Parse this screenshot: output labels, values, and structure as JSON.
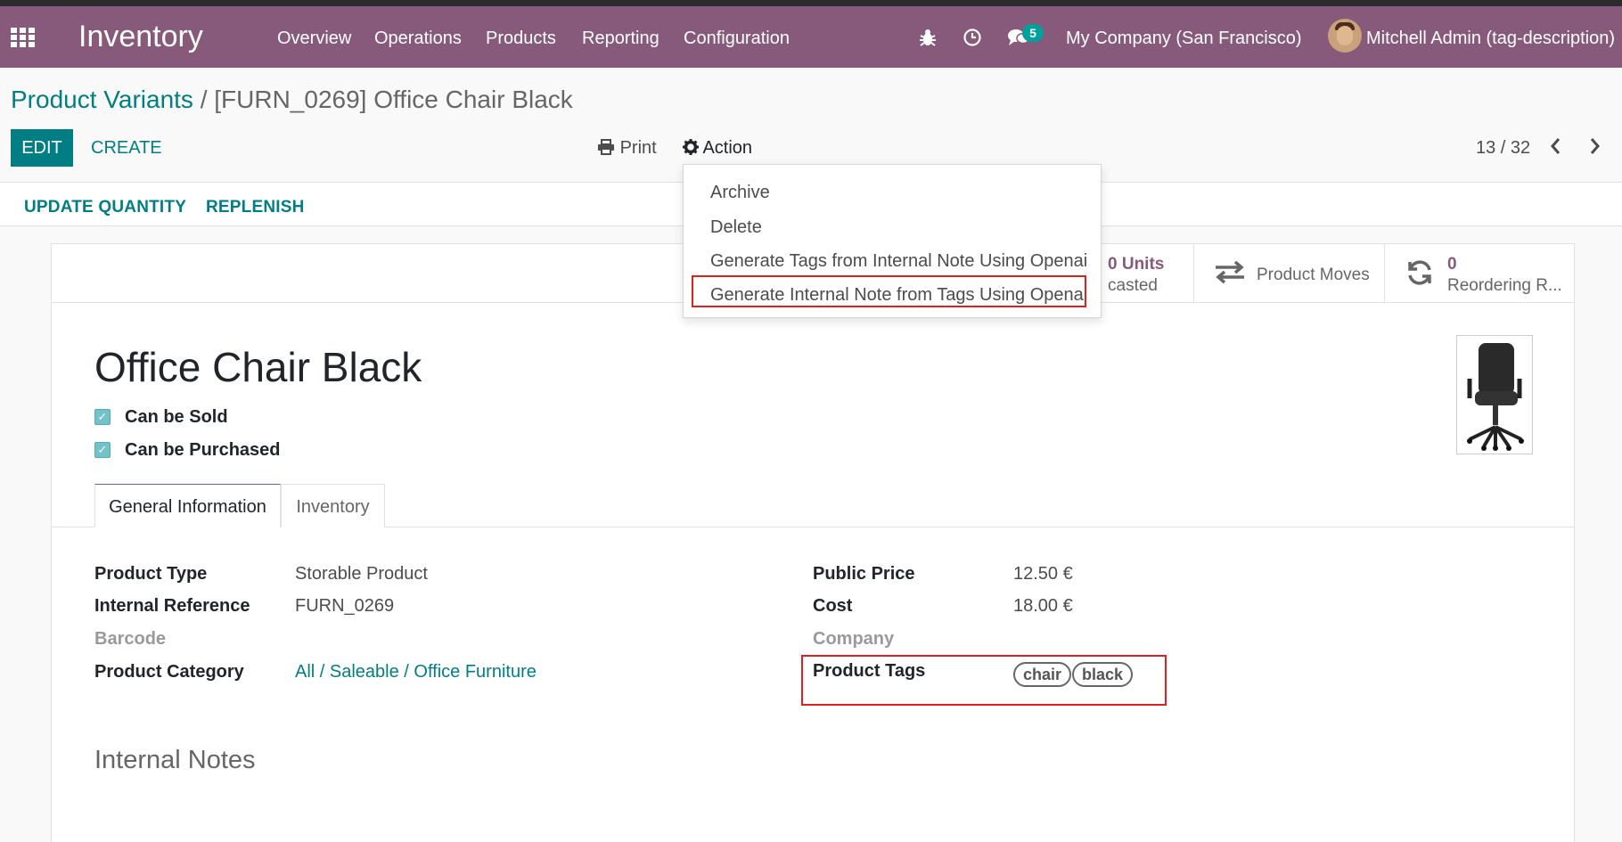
{
  "navbar": {
    "app_name": "Inventory",
    "menu": [
      "Overview",
      "Operations",
      "Products",
      "Reporting",
      "Configuration"
    ],
    "messages_count": "5",
    "company": "My Company (San Francisco)",
    "user": "Mitchell Admin (tag-description)",
    "icons": [
      "apps-grid-icon",
      "bug-icon",
      "clock-icon",
      "chat-icon"
    ],
    "bg_color": "#875a7b"
  },
  "breadcrumb": {
    "parent": "Product Variants",
    "separator": "/",
    "current": "[FURN_0269] Office Chair Black"
  },
  "toolbar": {
    "edit_label": "EDIT",
    "create_label": "CREATE",
    "print_label": "Print",
    "action_label": "Action",
    "pager": "13 / 32"
  },
  "statusbar": {
    "update_quantity_label": "UPDATE QUANTITY",
    "replenish_label": "REPLENISH"
  },
  "action_menu": {
    "items": [
      "Archive",
      "Delete",
      "Generate Tags from Internal Note Using Openai",
      "Generate Internal Note from Tags Using Openai"
    ],
    "highlighted_index": 3
  },
  "smart_buttons": {
    "forecast_value": "0 Units",
    "forecast_label": "casted",
    "moves_label": "Product Moves",
    "reorder_value": "0",
    "reorder_label": "Reordering R..."
  },
  "product": {
    "name": "Office Chair Black",
    "can_be_sold_label": "Can be Sold",
    "can_be_purchased_label": "Can be Purchased",
    "can_be_sold": true,
    "can_be_purchased": true
  },
  "tabs": [
    "General Information",
    "Inventory"
  ],
  "general_info": {
    "left": [
      {
        "label": "Product Type",
        "value": "Storable Product"
      },
      {
        "label": "Internal Reference",
        "value": "FURN_0269"
      },
      {
        "label": "Barcode",
        "value": ""
      },
      {
        "label": "Product Category",
        "value": "All / Saleable / Office Furniture"
      }
    ],
    "right": [
      {
        "label": "Public Price",
        "value": "12.50 €"
      },
      {
        "label": "Cost",
        "value": "18.00 €"
      },
      {
        "label": "Company",
        "value": ""
      },
      {
        "label": "Product Tags",
        "value": ""
      }
    ],
    "tags": [
      "chair",
      "black"
    ]
  },
  "internal_notes_heading": "Internal Notes",
  "colors": {
    "accent": "#017e84",
    "brand": "#875a7b",
    "highlight_box": "#e02020"
  }
}
